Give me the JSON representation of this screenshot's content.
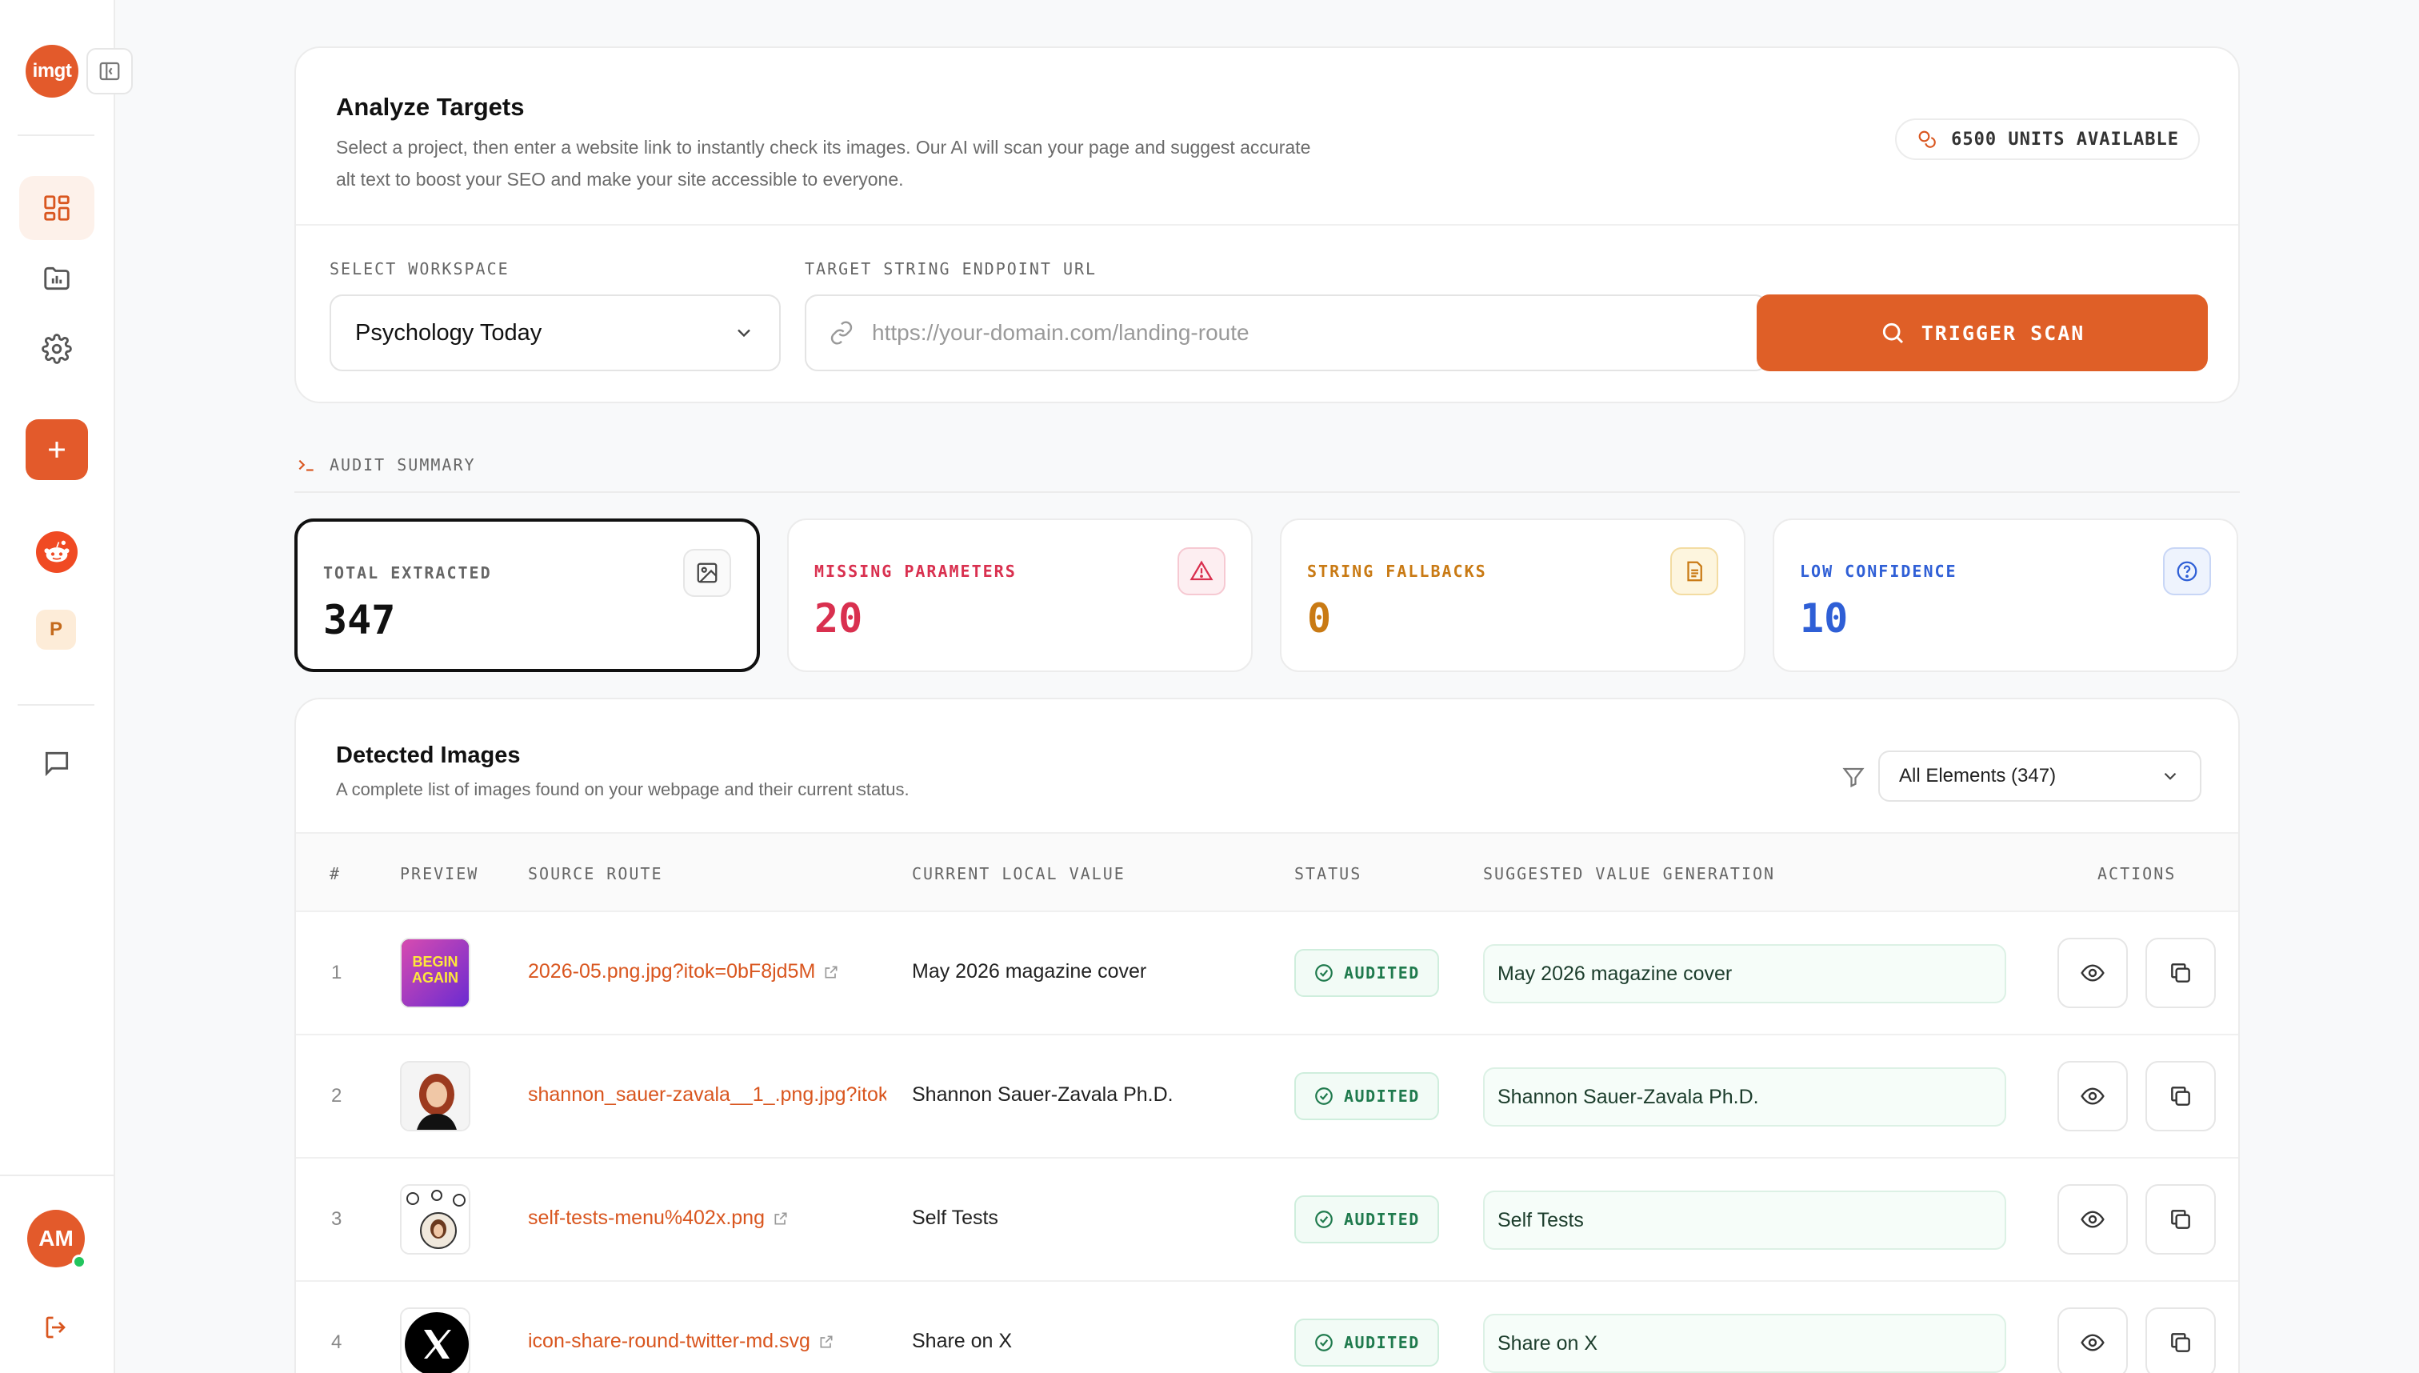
{
  "sidebar": {
    "logo_text": "imgt",
    "workspace_initial": "P",
    "user_initials": "AM"
  },
  "analyze": {
    "title": "Analyze Targets",
    "description": "Select a project, then enter a website link to instantly check its images. Our AI will scan your page and suggest accurate alt text to boost your SEO and make your site accessible to everyone.",
    "units_label": "6500 UNITS AVAILABLE",
    "workspace_label": "SELECT WORKSPACE",
    "workspace_value": "Psychology Today",
    "url_label": "TARGET STRING ENDPOINT URL",
    "url_placeholder": "https://your-domain.com/landing-route",
    "trigger_label": "TRIGGER SCAN"
  },
  "summary": {
    "label": "AUDIT SUMMARY",
    "stats": [
      {
        "label": "TOTAL EXTRACTED",
        "value": "347",
        "color": "#111111"
      },
      {
        "label": "MISSING PARAMETERS",
        "value": "20",
        "color": "#d9304f"
      },
      {
        "label": "STRING FALLBACKS",
        "value": "0",
        "color": "#c97a14"
      },
      {
        "label": "LOW CONFIDENCE",
        "value": "10",
        "color": "#2f5fd6"
      }
    ]
  },
  "detected": {
    "title": "Detected Images",
    "description": "A complete list of images found on your webpage and their current status.",
    "filter_value": "All Elements (347)",
    "columns": [
      "#",
      "PREVIEW",
      "SOURCE ROUTE",
      "CURRENT LOCAL VALUE",
      "STATUS",
      "SUGGESTED VALUE GENERATION",
      "ACTIONS"
    ],
    "rows": [
      {
        "num": "1",
        "source": "2026-05.png.jpg?itok=0bF8jd5M",
        "current": "May 2026 magazine cover",
        "status": "AUDITED",
        "suggested": "May 2026 magazine cover",
        "thumb_text": [
          "BEGIN",
          "AGAIN"
        ]
      },
      {
        "num": "2",
        "source": "shannon_sauer-zavala__1_.png.jpg?itok",
        "current": "Shannon Sauer-Zavala Ph.D.",
        "status": "AUDITED",
        "suggested": "Shannon Sauer-Zavala Ph.D."
      },
      {
        "num": "3",
        "source": "self-tests-menu%402x.png",
        "current": "Self Tests",
        "status": "AUDITED",
        "suggested": "Self Tests"
      },
      {
        "num": "4",
        "source": "icon-share-round-twitter-md.svg",
        "current": "Share on X",
        "status": "AUDITED",
        "suggested": "Share on X"
      }
    ]
  },
  "colors": {
    "accent": "#df5f27",
    "success": "#1f7a4d"
  }
}
